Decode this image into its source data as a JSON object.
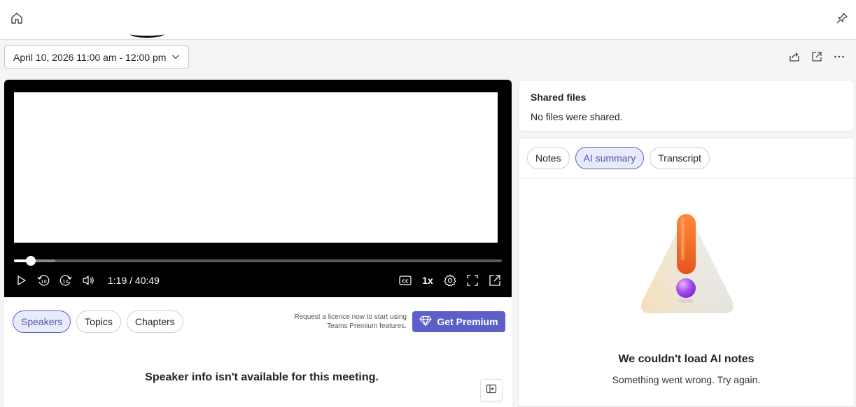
{
  "meeting": {
    "date_range": "April 10, 2026 11:00 am - 12:00 pm"
  },
  "player": {
    "time": "1:19 / 40:49",
    "speed": "1x",
    "progress": 0.034,
    "buffered": 0.084
  },
  "left_tabs": [
    {
      "label": "Speakers"
    },
    {
      "label": "Topics"
    },
    {
      "label": "Chapters"
    }
  ],
  "premium": {
    "note_line1": "Request a licence now to start using",
    "note_line2": "Teams Premium features.",
    "button_label": "Get Premium"
  },
  "speaker_message": "Speaker info isn't available for this meeting.",
  "shared_files": {
    "title": "Shared files",
    "message": "No files were shared."
  },
  "right_tabs": [
    {
      "label": "Notes"
    },
    {
      "label": "AI summary"
    },
    {
      "label": "Transcript"
    }
  ],
  "ai_error": {
    "title": "We couldn't load AI notes",
    "message": "Something went wrong. Try again."
  },
  "colors": {
    "accent": "#5b5fc7",
    "accent_light": "#e8ebfa",
    "player_bg": "#000000"
  }
}
